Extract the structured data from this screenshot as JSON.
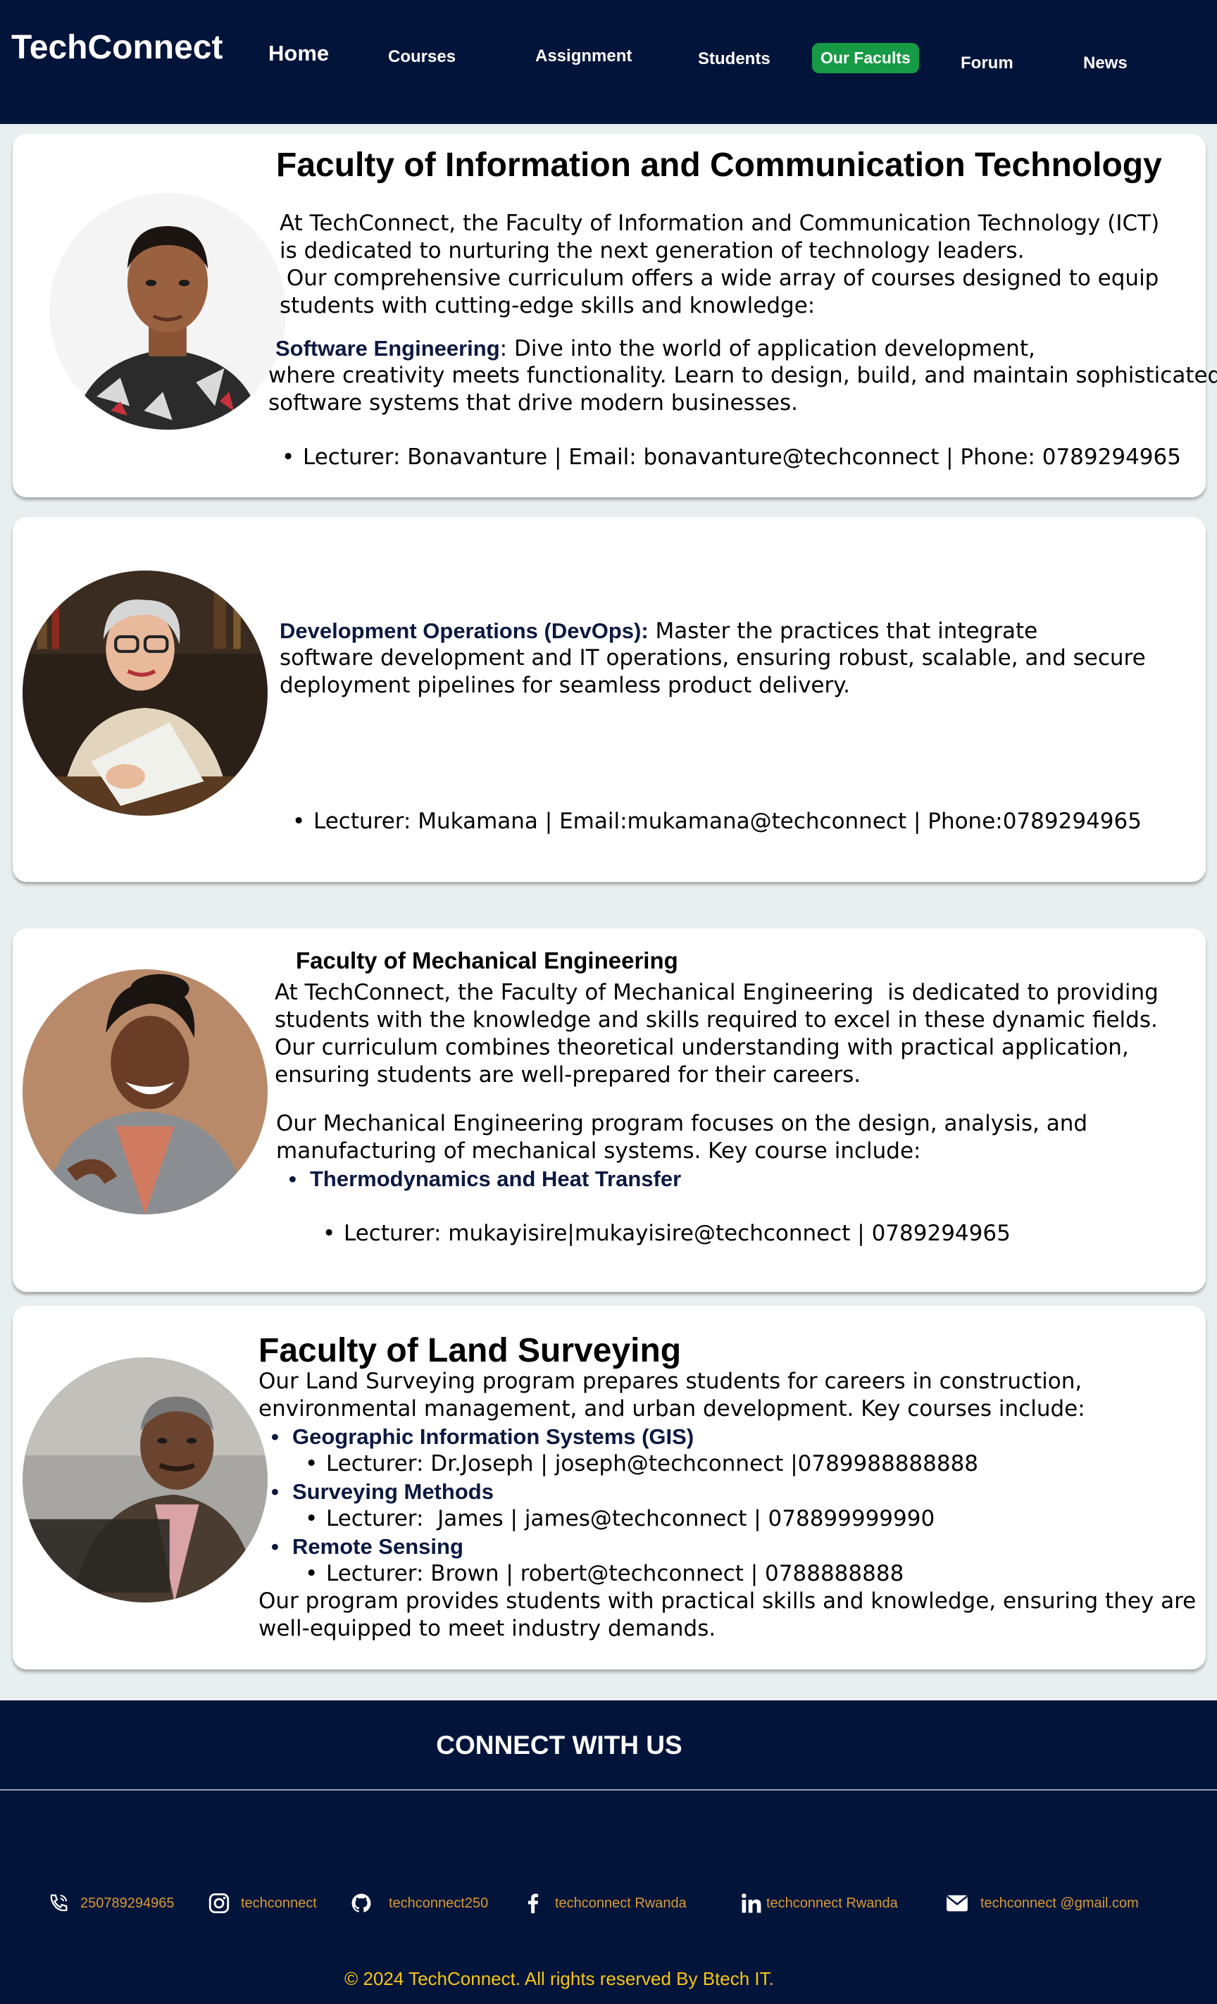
{
  "nav": {
    "brand": "TechConnect",
    "links": [
      "Home",
      "Courses",
      "Assignment",
      "Students",
      "Our Facults",
      "Forum",
      "News"
    ],
    "active_color": "#169a45",
    "bg_color": "#03143a"
  },
  "ict": {
    "title": "Faculty of Information and Communication Technology",
    "intro_lines": [
      "At TechConnect, the Faculty of Information and Communication Technology (ICT)",
      "is dedicated to nurturing the next generation of technology leaders.",
      " Our comprehensive curriculum offers a wide array of courses designed to equip",
      "students with cutting-edge skills and knowledge:"
    ],
    "course_name": "Software Engineering",
    "course_line1": ": Dive into the world of application development,",
    "course_lines": [
      "where creativity meets functionality. Learn to design, build, and maintain sophisticated",
      "software systems that drive modern businesses."
    ],
    "lecturer": "Lecturer: Bonavanture | Email: bonavanture@techconnect | Phone: 0789294965"
  },
  "devops": {
    "course_name": "Development Operations (DevOps):",
    "course_line1": " Master the practices that integrate",
    "course_lines": [
      "software development and IT operations, ensuring robust, scalable, and secure",
      "deployment pipelines for seamless product delivery."
    ],
    "lecturer": "Lecturer: Mukamana | Email:mukamana@techconnect | Phone:0789294965"
  },
  "mech": {
    "title": "Faculty of Mechanical Engineering",
    "intro_lines": [
      "At TechConnect, the Faculty of Mechanical Engineering  is dedicated to providing",
      "students with the knowledge and skills required to excel in these dynamic fields.",
      "Our curriculum combines theoretical understanding with practical application,",
      "ensuring students are well-prepared for their careers."
    ],
    "program_lines": [
      "Our Mechanical Engineering program focuses on the design, analysis, and",
      "manufacturing of mechanical systems. Key course include:"
    ],
    "course": "Thermodynamics and Heat Transfer",
    "lecturer": "Lecturer: mukayisire|mukayisire@techconnect | 0789294965"
  },
  "land": {
    "title": "Faculty of Land Surveying",
    "intro_lines": [
      "Our Land Surveying program prepares students for careers in construction,",
      "environmental management, and urban development. Key courses include:"
    ],
    "courses": [
      {
        "name": "Geographic Information Systems (GIS)",
        "lecturer": "Lecturer: Dr.Joseph | joseph@techconnect |0789988888888"
      },
      {
        "name": "Surveying Methods",
        "lecturer": "Lecturer:  James | james@techconnect | 078899999990"
      },
      {
        "name": "Remote Sensing",
        "lecturer": "Lecturer: Brown | robert@techconnect | 0788888888"
      }
    ],
    "outro_lines": [
      "Our program provides students with practical skills and knowledge, ensuring they are",
      "well-equipped to meet industry demands."
    ]
  },
  "footer": {
    "title": "CONNECT WITH US",
    "items": [
      {
        "icon": "phone-icon",
        "text": "250789294965"
      },
      {
        "icon": "instagram-icon",
        "text": "techconnect"
      },
      {
        "icon": "github-icon",
        "text": "techconnect250"
      },
      {
        "icon": "facebook-icon",
        "text": "techconnect Rwanda"
      },
      {
        "icon": "linkedin-icon",
        "text": "techconnect Rwanda"
      },
      {
        "icon": "envelope-icon",
        "text": "techconnect @gmail.com"
      }
    ],
    "copyright": "© 2024 TechConnect. All rights reserved By Btech IT.",
    "accent_color": "#d89a38",
    "copyright_color": "#f5c517"
  }
}
